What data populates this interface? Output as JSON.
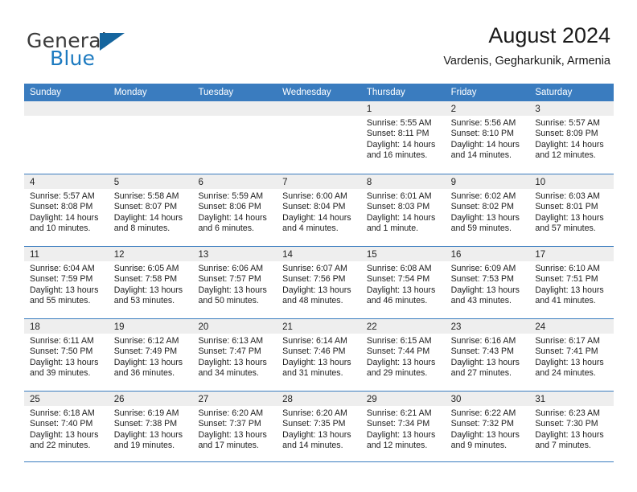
{
  "brand": {
    "name_part1": "General",
    "name_part2": "Blue",
    "triangle_icon": "triangle-icon",
    "accent_color": "#1c7ac0",
    "header_color": "#3a7cbf"
  },
  "header": {
    "title": "August 2024",
    "subtitle": "Vardenis, Gegharkunik, Armenia"
  },
  "weekdays": [
    "Sunday",
    "Monday",
    "Tuesday",
    "Wednesday",
    "Thursday",
    "Friday",
    "Saturday"
  ],
  "weeks": [
    [
      {
        "day": "",
        "sunrise": "",
        "sunset": "",
        "daylight_line1": "",
        "daylight_line2": ""
      },
      {
        "day": "",
        "sunrise": "",
        "sunset": "",
        "daylight_line1": "",
        "daylight_line2": ""
      },
      {
        "day": "",
        "sunrise": "",
        "sunset": "",
        "daylight_line1": "",
        "daylight_line2": ""
      },
      {
        "day": "",
        "sunrise": "",
        "sunset": "",
        "daylight_line1": "",
        "daylight_line2": ""
      },
      {
        "day": "1",
        "sunrise": "Sunrise: 5:55 AM",
        "sunset": "Sunset: 8:11 PM",
        "daylight_line1": "Daylight: 14 hours",
        "daylight_line2": "and 16 minutes."
      },
      {
        "day": "2",
        "sunrise": "Sunrise: 5:56 AM",
        "sunset": "Sunset: 8:10 PM",
        "daylight_line1": "Daylight: 14 hours",
        "daylight_line2": "and 14 minutes."
      },
      {
        "day": "3",
        "sunrise": "Sunrise: 5:57 AM",
        "sunset": "Sunset: 8:09 PM",
        "daylight_line1": "Daylight: 14 hours",
        "daylight_line2": "and 12 minutes."
      }
    ],
    [
      {
        "day": "4",
        "sunrise": "Sunrise: 5:57 AM",
        "sunset": "Sunset: 8:08 PM",
        "daylight_line1": "Daylight: 14 hours",
        "daylight_line2": "and 10 minutes."
      },
      {
        "day": "5",
        "sunrise": "Sunrise: 5:58 AM",
        "sunset": "Sunset: 8:07 PM",
        "daylight_line1": "Daylight: 14 hours",
        "daylight_line2": "and 8 minutes."
      },
      {
        "day": "6",
        "sunrise": "Sunrise: 5:59 AM",
        "sunset": "Sunset: 8:06 PM",
        "daylight_line1": "Daylight: 14 hours",
        "daylight_line2": "and 6 minutes."
      },
      {
        "day": "7",
        "sunrise": "Sunrise: 6:00 AM",
        "sunset": "Sunset: 8:04 PM",
        "daylight_line1": "Daylight: 14 hours",
        "daylight_line2": "and 4 minutes."
      },
      {
        "day": "8",
        "sunrise": "Sunrise: 6:01 AM",
        "sunset": "Sunset: 8:03 PM",
        "daylight_line1": "Daylight: 14 hours",
        "daylight_line2": "and 1 minute."
      },
      {
        "day": "9",
        "sunrise": "Sunrise: 6:02 AM",
        "sunset": "Sunset: 8:02 PM",
        "daylight_line1": "Daylight: 13 hours",
        "daylight_line2": "and 59 minutes."
      },
      {
        "day": "10",
        "sunrise": "Sunrise: 6:03 AM",
        "sunset": "Sunset: 8:01 PM",
        "daylight_line1": "Daylight: 13 hours",
        "daylight_line2": "and 57 minutes."
      }
    ],
    [
      {
        "day": "11",
        "sunrise": "Sunrise: 6:04 AM",
        "sunset": "Sunset: 7:59 PM",
        "daylight_line1": "Daylight: 13 hours",
        "daylight_line2": "and 55 minutes."
      },
      {
        "day": "12",
        "sunrise": "Sunrise: 6:05 AM",
        "sunset": "Sunset: 7:58 PM",
        "daylight_line1": "Daylight: 13 hours",
        "daylight_line2": "and 53 minutes."
      },
      {
        "day": "13",
        "sunrise": "Sunrise: 6:06 AM",
        "sunset": "Sunset: 7:57 PM",
        "daylight_line1": "Daylight: 13 hours",
        "daylight_line2": "and 50 minutes."
      },
      {
        "day": "14",
        "sunrise": "Sunrise: 6:07 AM",
        "sunset": "Sunset: 7:56 PM",
        "daylight_line1": "Daylight: 13 hours",
        "daylight_line2": "and 48 minutes."
      },
      {
        "day": "15",
        "sunrise": "Sunrise: 6:08 AM",
        "sunset": "Sunset: 7:54 PM",
        "daylight_line1": "Daylight: 13 hours",
        "daylight_line2": "and 46 minutes."
      },
      {
        "day": "16",
        "sunrise": "Sunrise: 6:09 AM",
        "sunset": "Sunset: 7:53 PM",
        "daylight_line1": "Daylight: 13 hours",
        "daylight_line2": "and 43 minutes."
      },
      {
        "day": "17",
        "sunrise": "Sunrise: 6:10 AM",
        "sunset": "Sunset: 7:51 PM",
        "daylight_line1": "Daylight: 13 hours",
        "daylight_line2": "and 41 minutes."
      }
    ],
    [
      {
        "day": "18",
        "sunrise": "Sunrise: 6:11 AM",
        "sunset": "Sunset: 7:50 PM",
        "daylight_line1": "Daylight: 13 hours",
        "daylight_line2": "and 39 minutes."
      },
      {
        "day": "19",
        "sunrise": "Sunrise: 6:12 AM",
        "sunset": "Sunset: 7:49 PM",
        "daylight_line1": "Daylight: 13 hours",
        "daylight_line2": "and 36 minutes."
      },
      {
        "day": "20",
        "sunrise": "Sunrise: 6:13 AM",
        "sunset": "Sunset: 7:47 PM",
        "daylight_line1": "Daylight: 13 hours",
        "daylight_line2": "and 34 minutes."
      },
      {
        "day": "21",
        "sunrise": "Sunrise: 6:14 AM",
        "sunset": "Sunset: 7:46 PM",
        "daylight_line1": "Daylight: 13 hours",
        "daylight_line2": "and 31 minutes."
      },
      {
        "day": "22",
        "sunrise": "Sunrise: 6:15 AM",
        "sunset": "Sunset: 7:44 PM",
        "daylight_line1": "Daylight: 13 hours",
        "daylight_line2": "and 29 minutes."
      },
      {
        "day": "23",
        "sunrise": "Sunrise: 6:16 AM",
        "sunset": "Sunset: 7:43 PM",
        "daylight_line1": "Daylight: 13 hours",
        "daylight_line2": "and 27 minutes."
      },
      {
        "day": "24",
        "sunrise": "Sunrise: 6:17 AM",
        "sunset": "Sunset: 7:41 PM",
        "daylight_line1": "Daylight: 13 hours",
        "daylight_line2": "and 24 minutes."
      }
    ],
    [
      {
        "day": "25",
        "sunrise": "Sunrise: 6:18 AM",
        "sunset": "Sunset: 7:40 PM",
        "daylight_line1": "Daylight: 13 hours",
        "daylight_line2": "and 22 minutes."
      },
      {
        "day": "26",
        "sunrise": "Sunrise: 6:19 AM",
        "sunset": "Sunset: 7:38 PM",
        "daylight_line1": "Daylight: 13 hours",
        "daylight_line2": "and 19 minutes."
      },
      {
        "day": "27",
        "sunrise": "Sunrise: 6:20 AM",
        "sunset": "Sunset: 7:37 PM",
        "daylight_line1": "Daylight: 13 hours",
        "daylight_line2": "and 17 minutes."
      },
      {
        "day": "28",
        "sunrise": "Sunrise: 6:20 AM",
        "sunset": "Sunset: 7:35 PM",
        "daylight_line1": "Daylight: 13 hours",
        "daylight_line2": "and 14 minutes."
      },
      {
        "day": "29",
        "sunrise": "Sunrise: 6:21 AM",
        "sunset": "Sunset: 7:34 PM",
        "daylight_line1": "Daylight: 13 hours",
        "daylight_line2": "and 12 minutes."
      },
      {
        "day": "30",
        "sunrise": "Sunrise: 6:22 AM",
        "sunset": "Sunset: 7:32 PM",
        "daylight_line1": "Daylight: 13 hours",
        "daylight_line2": "and 9 minutes."
      },
      {
        "day": "31",
        "sunrise": "Sunrise: 6:23 AM",
        "sunset": "Sunset: 7:30 PM",
        "daylight_line1": "Daylight: 13 hours",
        "daylight_line2": "and 7 minutes."
      }
    ]
  ]
}
